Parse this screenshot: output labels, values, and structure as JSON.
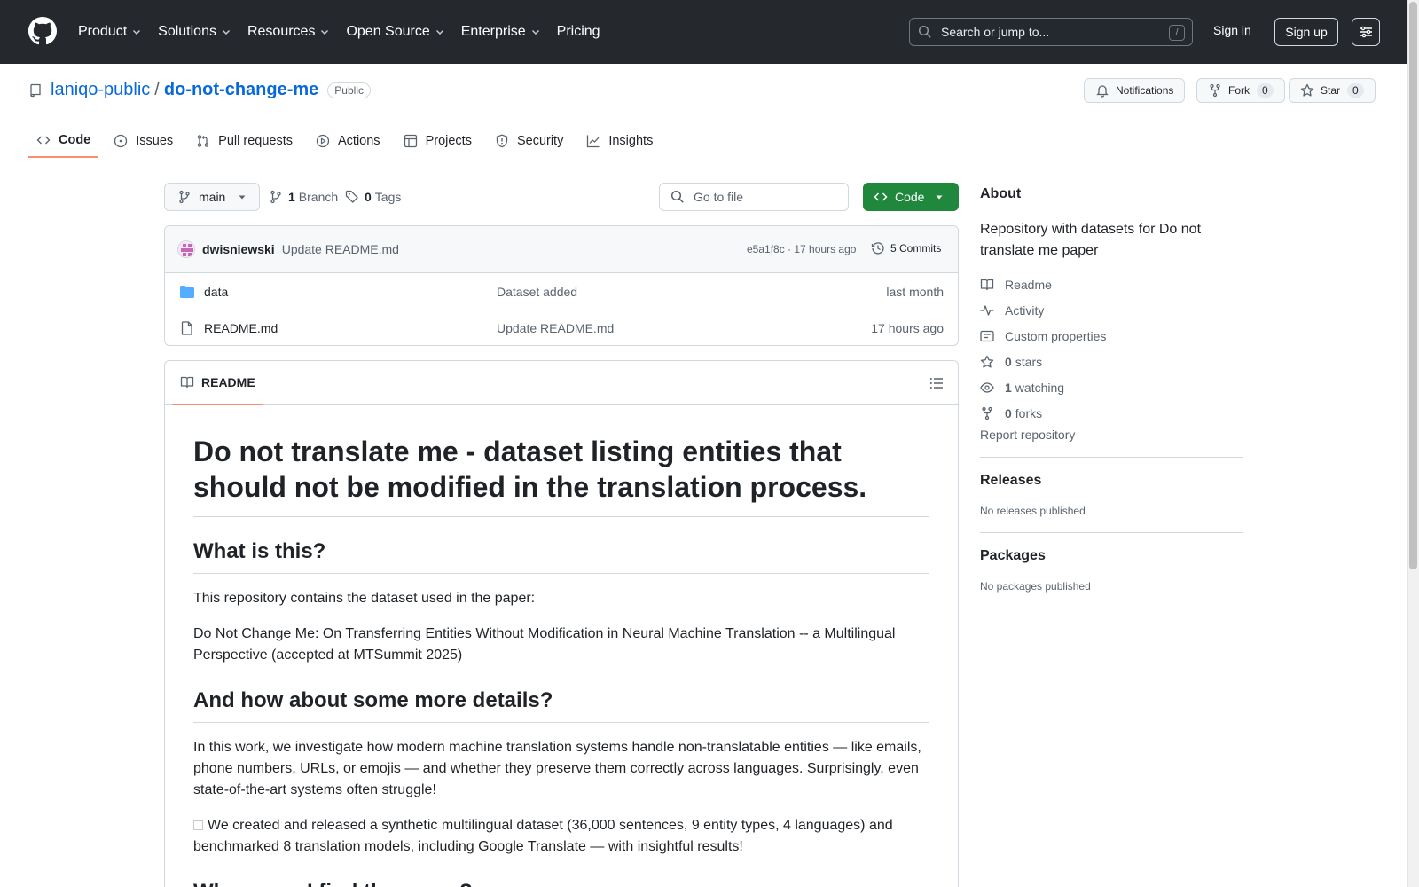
{
  "header": {
    "nav": [
      "Product",
      "Solutions",
      "Resources",
      "Open Source",
      "Enterprise",
      "Pricing"
    ],
    "search_placeholder": "Search or jump to...",
    "search_shortcut": "/",
    "signin": "Sign in",
    "signup": "Sign up"
  },
  "repo": {
    "owner": "laniqo-public",
    "separator": "/",
    "name": "do-not-change-me",
    "visibility": "Public",
    "notifications_label": "Notifications",
    "fork_label": "Fork",
    "fork_count": "0",
    "star_label": "Star",
    "star_count": "0"
  },
  "tabs": [
    "Code",
    "Issues",
    "Pull requests",
    "Actions",
    "Projects",
    "Security",
    "Insights"
  ],
  "branch": {
    "name": "main",
    "branch_count": "1",
    "branch_label": "Branch",
    "tag_count": "0",
    "tag_label": "Tags",
    "goto_placeholder": "Go to file",
    "code_label": "Code"
  },
  "commit": {
    "author": "dwisniewski",
    "message": "Update README.md",
    "hash_time": "e5a1f8c · 17 hours ago",
    "commits": "5 Commits"
  },
  "files": [
    {
      "name": "data",
      "message": "Dataset added",
      "date": "last month"
    },
    {
      "name": "README.md",
      "message": "Update README.md",
      "date": "17 hours ago"
    }
  ],
  "readme": {
    "tab": "README",
    "h1": "Do not translate me - dataset listing entities that should not be modified in the translation process.",
    "h2_1": "What is this?",
    "p1": "This repository contains the dataset used in the paper:",
    "p2": "Do Not Change Me: On Transferring Entities Without Modification in Neural Machine Translation -- a Multilingual Perspective (accepted at MTSummit 2025)",
    "h2_2": "And how about some more details?",
    "p3": "In this work, we investigate how modern machine translation systems handle non-translatable entities — like emails, phone numbers, URLs, or emojis — and whether they preserve them correctly across languages. Surprisingly, even state-of-the-art systems often struggle!",
    "p4": "We created and released a synthetic multilingual dataset (36,000 sentences, 9 entity types, 4 languages) and benchmarked 8 translation models, including Google Translate — with insightful results!",
    "h2_3": "Where can I find the paper?"
  },
  "about": {
    "title": "About",
    "description": "Repository with datasets for Do not translate me paper",
    "readme": "Readme",
    "activity": "Activity",
    "custom_properties": "Custom properties",
    "stars_count": "0",
    "stars_label": "stars",
    "watching_count": "1",
    "watching_label": "watching",
    "forks_count": "0",
    "forks_label": "forks",
    "report": "Report repository"
  },
  "releases": {
    "title": "Releases",
    "text": "No releases published"
  },
  "packages": {
    "title": "Packages",
    "text": "No packages published"
  },
  "colors": {
    "header_bg": "#25292e",
    "link": "#0969da",
    "code_button": "#1f883d",
    "tab_underline": "#fd8c73"
  }
}
